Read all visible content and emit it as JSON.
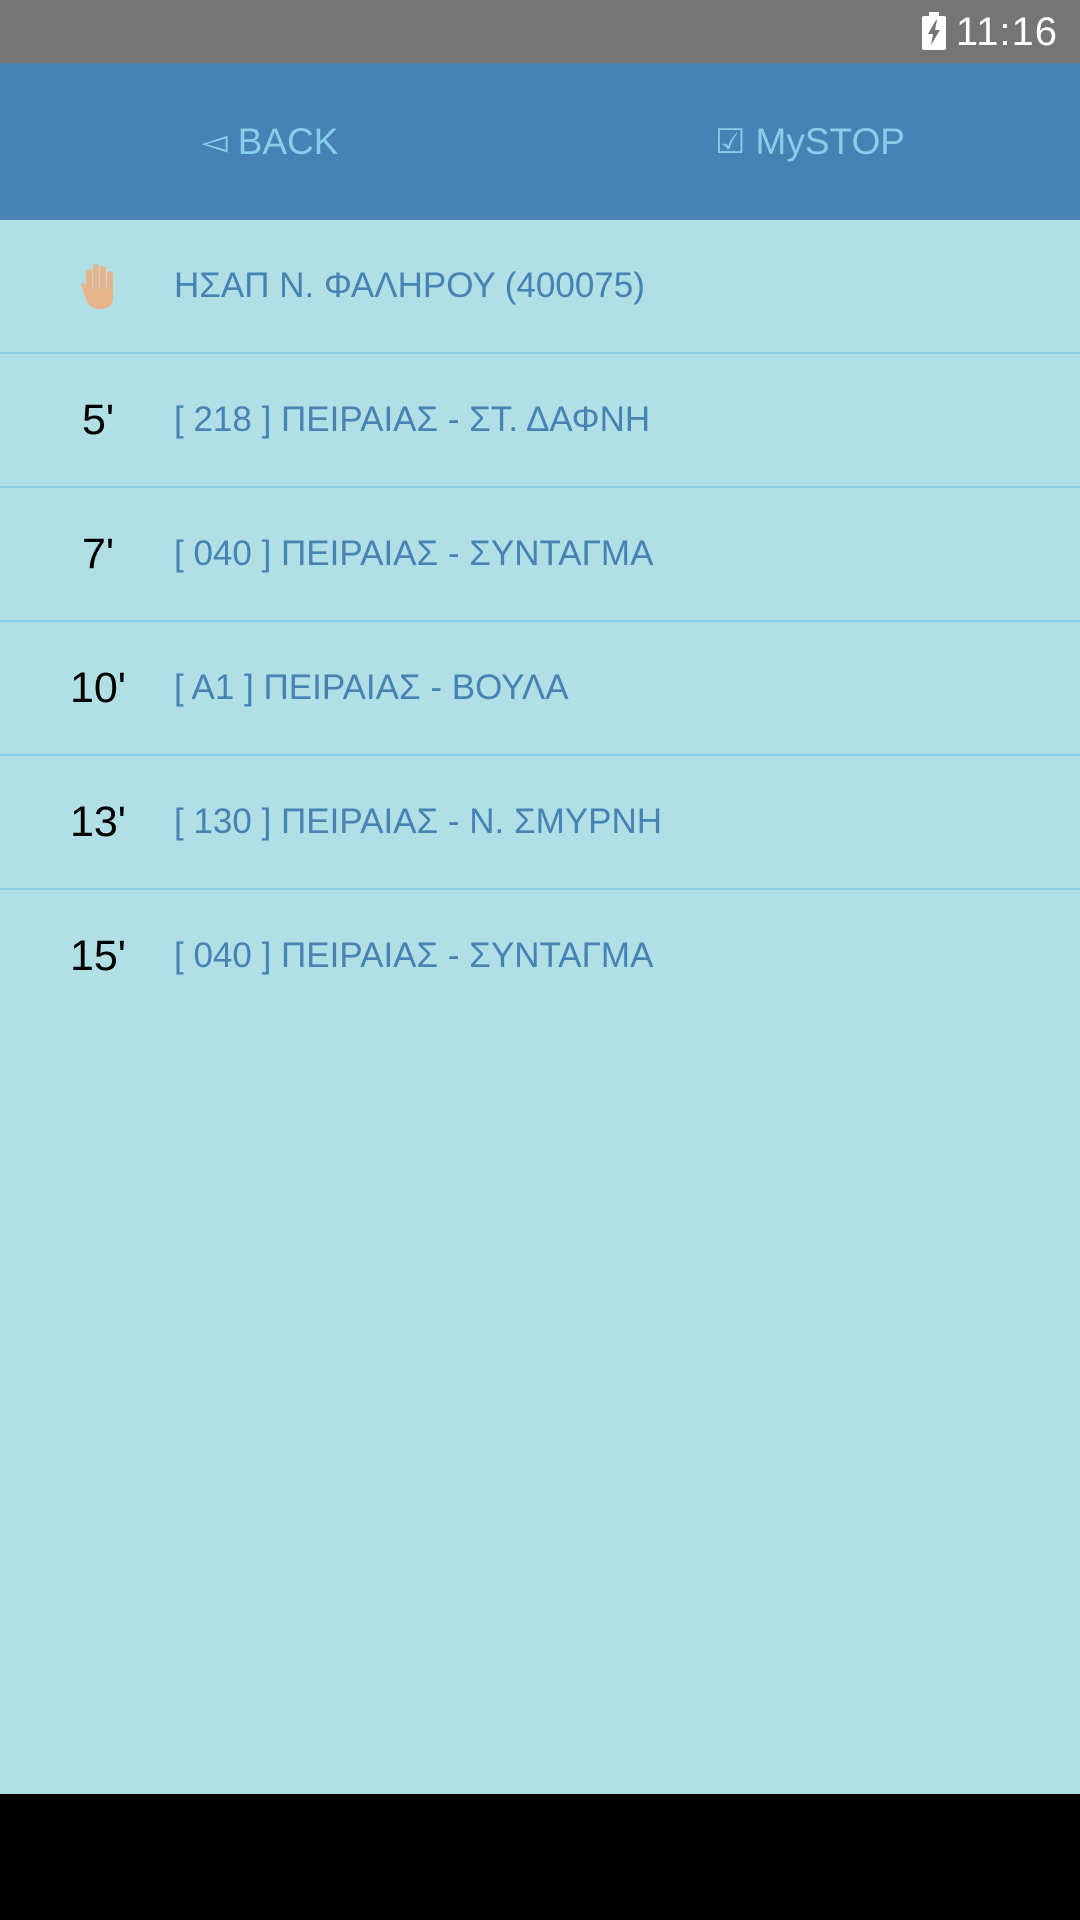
{
  "status_bar": {
    "time": "11:16",
    "battery_icon": "battery-charging-icon"
  },
  "header": {
    "back_glyph": "◅",
    "back_label": "BACK",
    "mystop_glyph": "☑",
    "mystop_label": "MySTOP"
  },
  "stop": {
    "icon": "raised-hand-icon",
    "name": "ΗΣΑΠ Ν. ΦΑΛΗΡΟΥ (400075)"
  },
  "arrivals": [
    {
      "minutes": "5'",
      "route": "[ 218 ] ΠΕΙΡΑΙΑΣ - ΣΤ. ΔΑΦΝΗ"
    },
    {
      "minutes": "7'",
      "route": "[ 040 ] ΠΕΙΡΑΙΑΣ - ΣΥΝΤΑΓΜΑ"
    },
    {
      "minutes": "10'",
      "route": "[ Α1 ] ΠΕΙΡΑΙΑΣ - ΒΟΥΛΑ"
    },
    {
      "minutes": "13'",
      "route": "[ 130 ] ΠΕΙΡΑΙΑΣ - Ν. ΣΜΥΡΝΗ"
    },
    {
      "minutes": "15'",
      "route": "[ 040 ] ΠΕΙΡΑΙΑΣ - ΣΥΝΤΑΓΜΑ"
    }
  ],
  "colors": {
    "header_bg": "#4682b4",
    "header_text": "#87ceeb",
    "list_bg": "#b0dfe5",
    "divider": "#87ceeb",
    "route_text": "#4682b4"
  }
}
